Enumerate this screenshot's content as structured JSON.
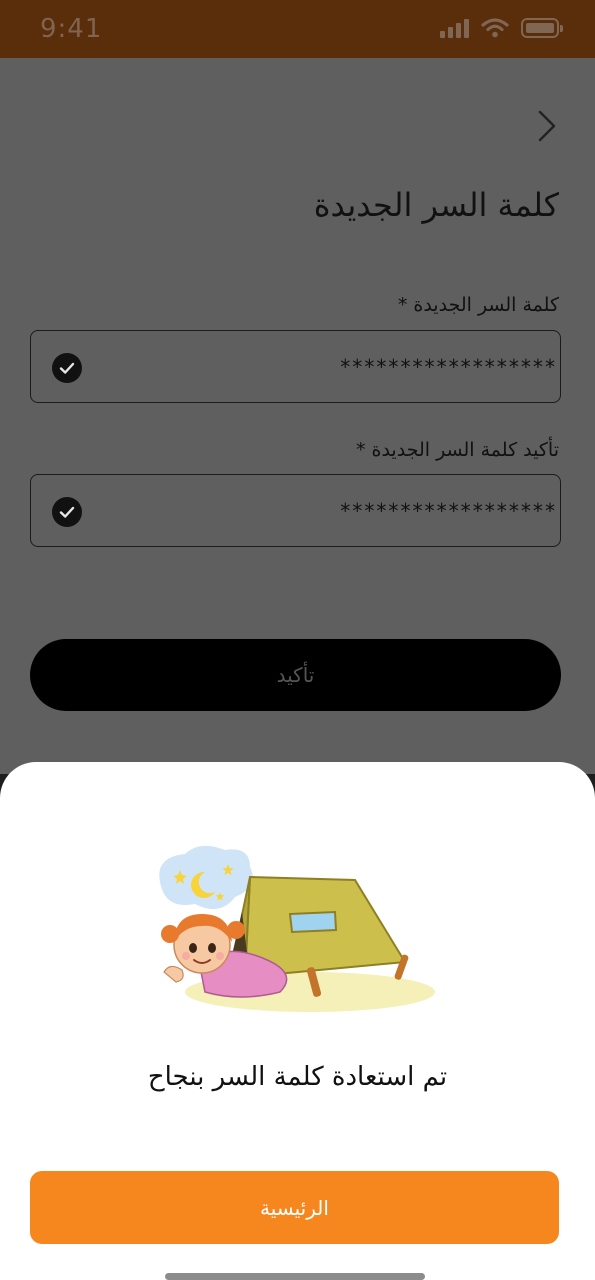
{
  "status_bar": {
    "time": "9:41",
    "icons": [
      "signal-icon",
      "wifi-icon",
      "battery-icon"
    ],
    "background": "#5a2d0b"
  },
  "header": {
    "back_icon": "chevron-right-icon",
    "title": "كلمة السر الجديدة"
  },
  "form": {
    "new_password": {
      "label": "كلمة السر الجديدة *",
      "value": "******************",
      "status_icon": "check-circle-icon"
    },
    "confirm_password": {
      "label": "تأكيد كلمة السر الجديدة *",
      "value": "******************",
      "status_icon": "check-circle-icon"
    },
    "submit_label": "تأكيد"
  },
  "success_sheet": {
    "illustration": "girl-in-tent-illustration",
    "message": "تم استعادة كلمة السر بنجاح",
    "home_button_label": "الرئيسية",
    "accent_color": "#f6871f"
  }
}
